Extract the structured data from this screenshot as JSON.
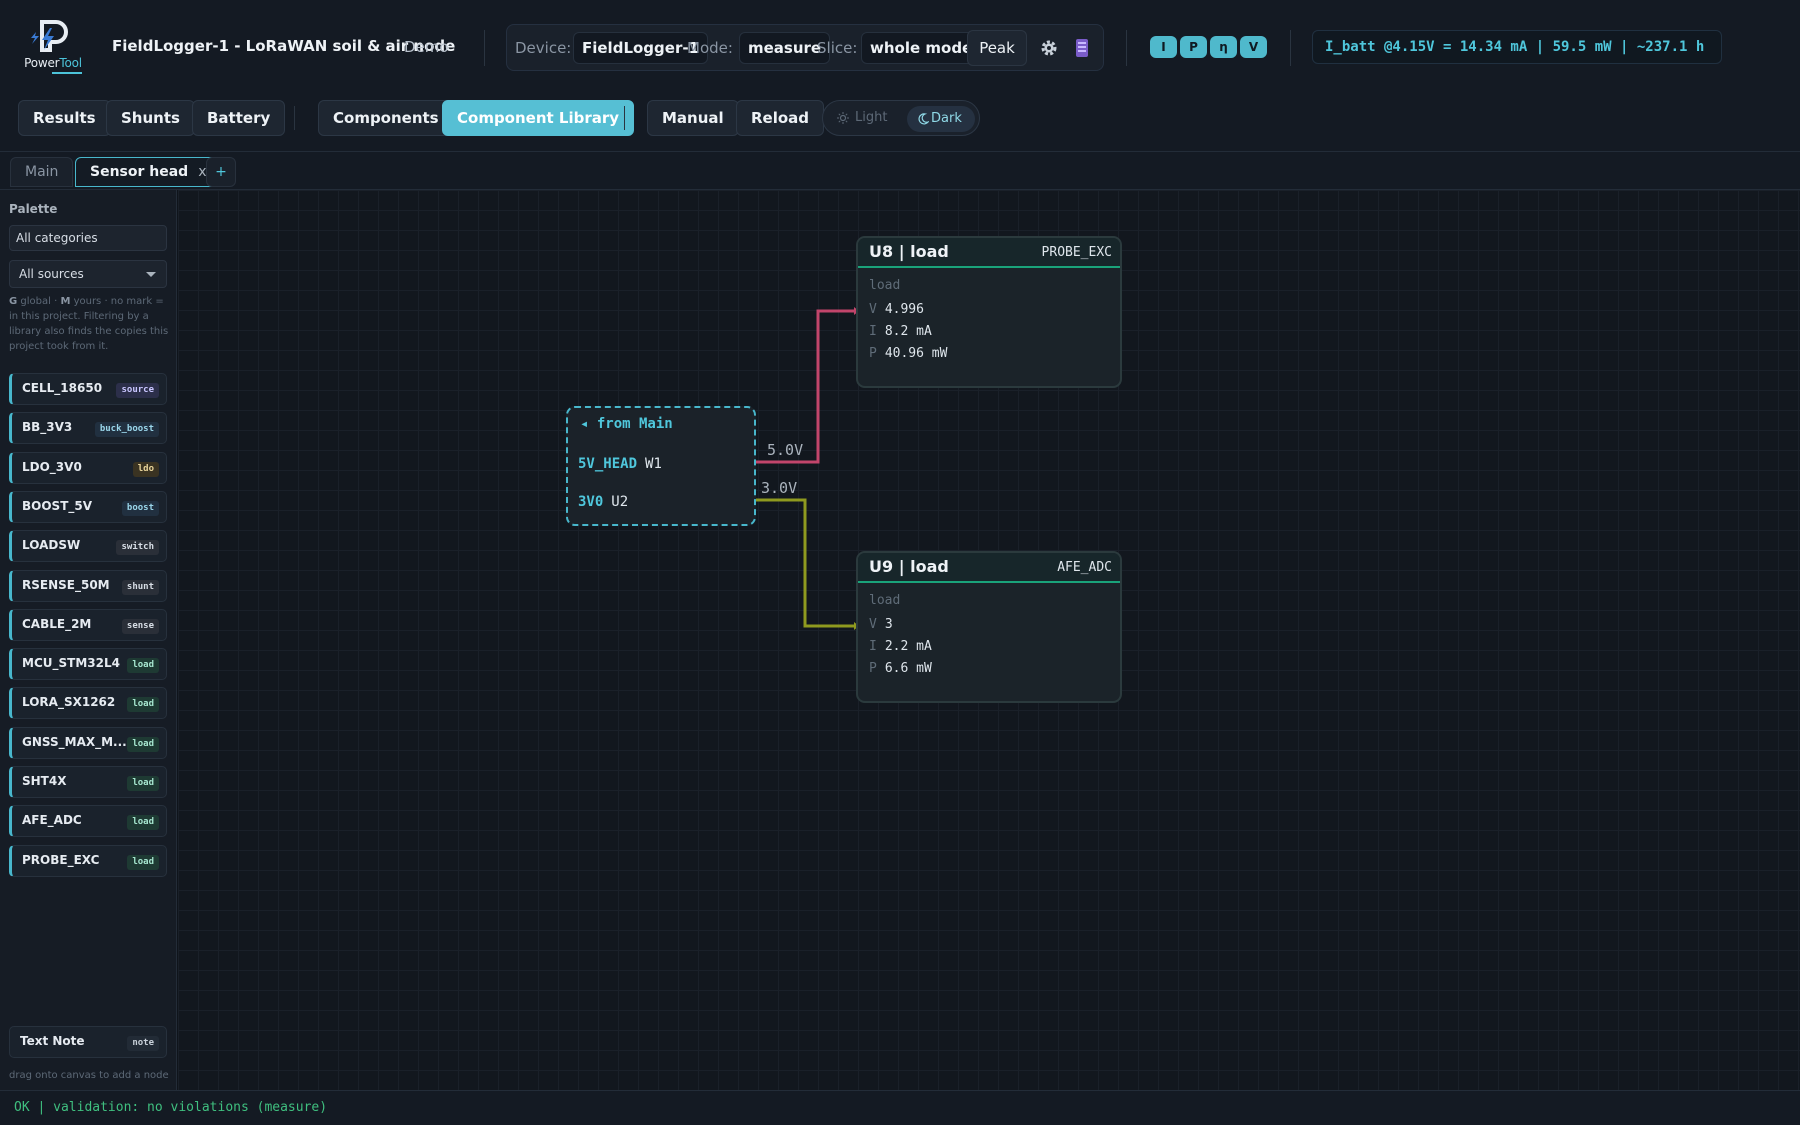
{
  "app": {
    "logo_word_1": "Power",
    "logo_word_2": "Tool",
    "title": "FieldLogger-1 - LoRaWAN soil & air node",
    "demo_label": "Demo"
  },
  "device_bar": {
    "device_label": "Device:",
    "device_value": "FieldLogger-1",
    "mode_label": "Mode:",
    "mode_value": "measure",
    "slice_label": "Slice:",
    "slice_value": "whole mode",
    "peak_label": "Peak"
  },
  "metric_toggles": [
    "I",
    "P",
    "η",
    "V"
  ],
  "battery_readout": "I_batt @4.15V = 14.34 mA | 59.5 mW | ~237.1 h",
  "nav": {
    "results": "Results",
    "shunts": "Shunts",
    "battery": "Battery",
    "components": "Components",
    "component_library": "Component Library",
    "manual": "Manual",
    "reload": "Reload",
    "theme_light": "Light",
    "theme_dark": "Dark"
  },
  "tabs": {
    "main": "Main",
    "sensor_head": "Sensor head",
    "close": "x",
    "add": "+"
  },
  "sidebar": {
    "title": "Palette",
    "category_value": "All categories",
    "source_value": "All sources",
    "help_global": "G",
    "help_global_text": " global · ",
    "help_mine": "M",
    "help_rest": " yours · no mark = in this project. Filtering by a library also finds the copies this project took from it.",
    "items": [
      {
        "name": "CELL_18650",
        "badge": "source"
      },
      {
        "name": "BB_3V3",
        "badge": "buck_boost"
      },
      {
        "name": "LDO_3V0",
        "badge": "ldo"
      },
      {
        "name": "BOOST_5V",
        "badge": "boost"
      },
      {
        "name": "LOADSW",
        "badge": "switch"
      },
      {
        "name": "RSENSE_50M",
        "badge": "shunt"
      },
      {
        "name": "CABLE_2M",
        "badge": "sense"
      },
      {
        "name": "MCU_STM32L4",
        "badge": "load"
      },
      {
        "name": "LORA_SX1262",
        "badge": "load"
      },
      {
        "name": "GNSS_MAX_M...",
        "badge": "load"
      },
      {
        "name": "SHT4X",
        "badge": "load"
      },
      {
        "name": "AFE_ADC",
        "badge": "load"
      },
      {
        "name": "PROBE_EXC",
        "badge": "load"
      }
    ],
    "note_item": {
      "name": "Text Note",
      "badge": "note"
    },
    "drag_help": "drag onto canvas to add a node"
  },
  "canvas": {
    "port_node": {
      "title": "from Main",
      "ports": [
        {
          "net": "5V_HEAD",
          "ref": "W1",
          "voltage": "5.0V"
        },
        {
          "net": "3V0",
          "ref": "U2",
          "voltage": "3.0V"
        }
      ]
    },
    "nodes": [
      {
        "title": "U8 | load",
        "tag": "PROBE_EXC",
        "kind": "load",
        "v_label": "V",
        "v": "4.996",
        "i_label": "I",
        "i": "8.2 mA",
        "p_label": "P",
        "p": "40.96 mW"
      },
      {
        "title": "U9 | load",
        "tag": "AFE_ADC",
        "kind": "load",
        "v_label": "V",
        "v": "3",
        "i_label": "I",
        "i": "2.2 mA",
        "p_label": "P",
        "p": "6.6 mW"
      }
    ],
    "wire_colors": {
      "5v": "#c2456b",
      "3v": "#8f9a1f"
    }
  },
  "status": "OK | validation: no violations (measure)"
}
